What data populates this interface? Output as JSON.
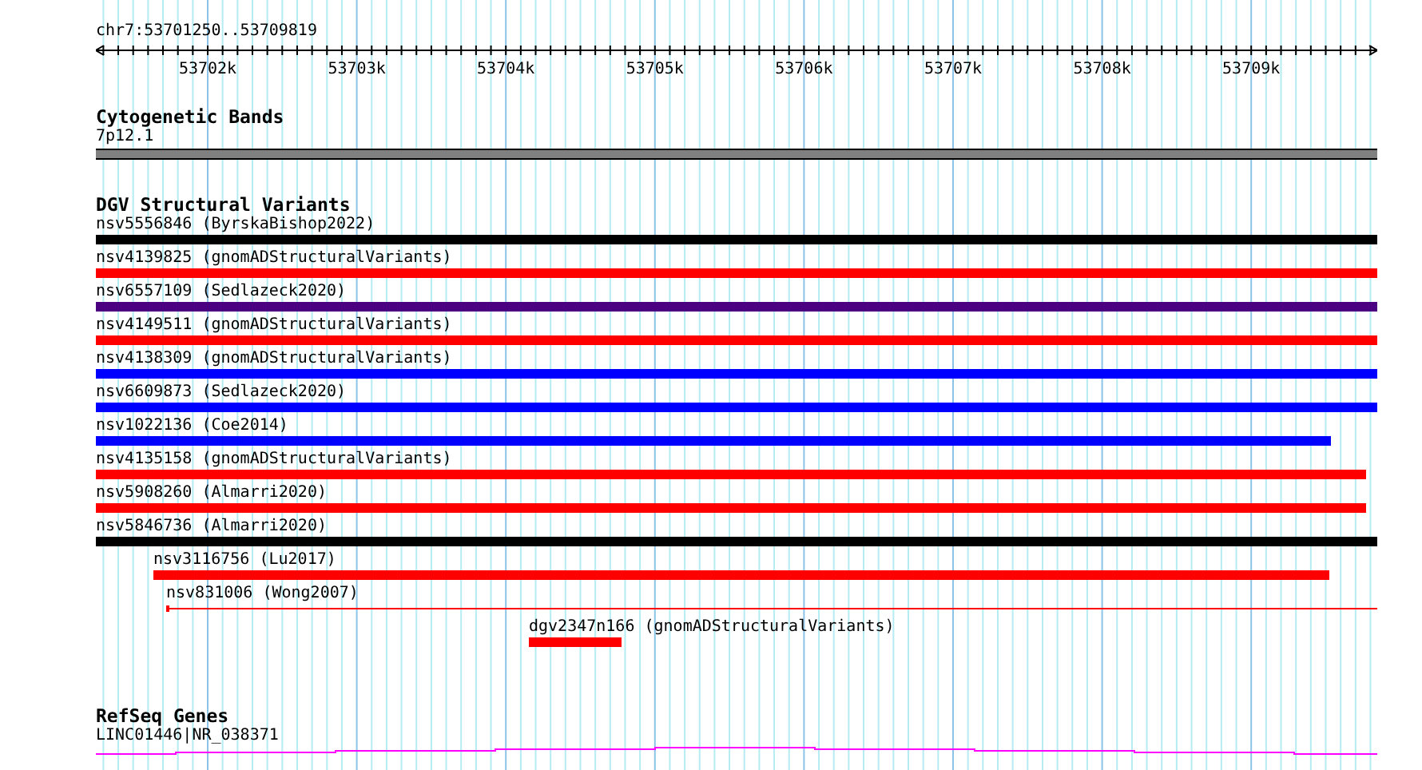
{
  "ruler": {
    "location": "chr7:53701250..53709819",
    "ticks": [
      "53702k",
      "53703k",
      "53704k",
      "53705k",
      "53706k",
      "53707k",
      "53708k",
      "53709k"
    ]
  },
  "tracks": [
    {
      "kind": "bands",
      "title": "Cytogenetic Bands",
      "features": [
        {
          "label": "7p12.1",
          "kind": "band"
        }
      ]
    },
    {
      "kind": "variants",
      "title": "DGV Structural Variants",
      "features": [
        {
          "label": "nsv5556846 (ByrskaBishop2022)",
          "kind": "bar",
          "color": "#000000"
        },
        {
          "label": "nsv4139825 (gnomADStructuralVariants)",
          "kind": "bar",
          "color": "#ff0000"
        },
        {
          "label": "nsv6557109 (Sedlazeck2020)",
          "kind": "bar",
          "color": "#4b0082"
        },
        {
          "label": "nsv4149511 (gnomADStructuralVariants)",
          "kind": "bar",
          "color": "#ff0000"
        },
        {
          "label": "nsv4138309 (gnomADStructuralVariants)",
          "kind": "bar",
          "color": "#0000ff"
        },
        {
          "label": "nsv6609873 (Sedlazeck2020)",
          "kind": "bar",
          "color": "#0000ff"
        },
        {
          "label": "nsv1022136 (Coe2014)",
          "kind": "bar",
          "color": "#0000ff"
        },
        {
          "label": "nsv4135158 (gnomADStructuralVariants)",
          "kind": "bar",
          "color": "#ff0000"
        },
        {
          "label": "nsv5908260 (Almarri2020)",
          "kind": "bar",
          "color": "#ff0000"
        },
        {
          "label": "nsv5846736 (Almarri2020)",
          "kind": "bar",
          "color": "#000000"
        },
        {
          "label": "nsv3116756 (Lu2017)",
          "kind": "bar",
          "color": "#ff0000"
        },
        {
          "label": "nsv831006 (Wong2007)",
          "kind": "line",
          "color": "#ff0000"
        },
        {
          "label": "dgv2347n166 (gnomADStructuralVariants)",
          "kind": "bar",
          "color": "#ff0000"
        }
      ]
    },
    {
      "kind": "genes",
      "title": "RefSeq Genes",
      "features": [
        {
          "label": "LINC01446|NR_038371",
          "kind": "gene"
        }
      ]
    }
  ]
}
